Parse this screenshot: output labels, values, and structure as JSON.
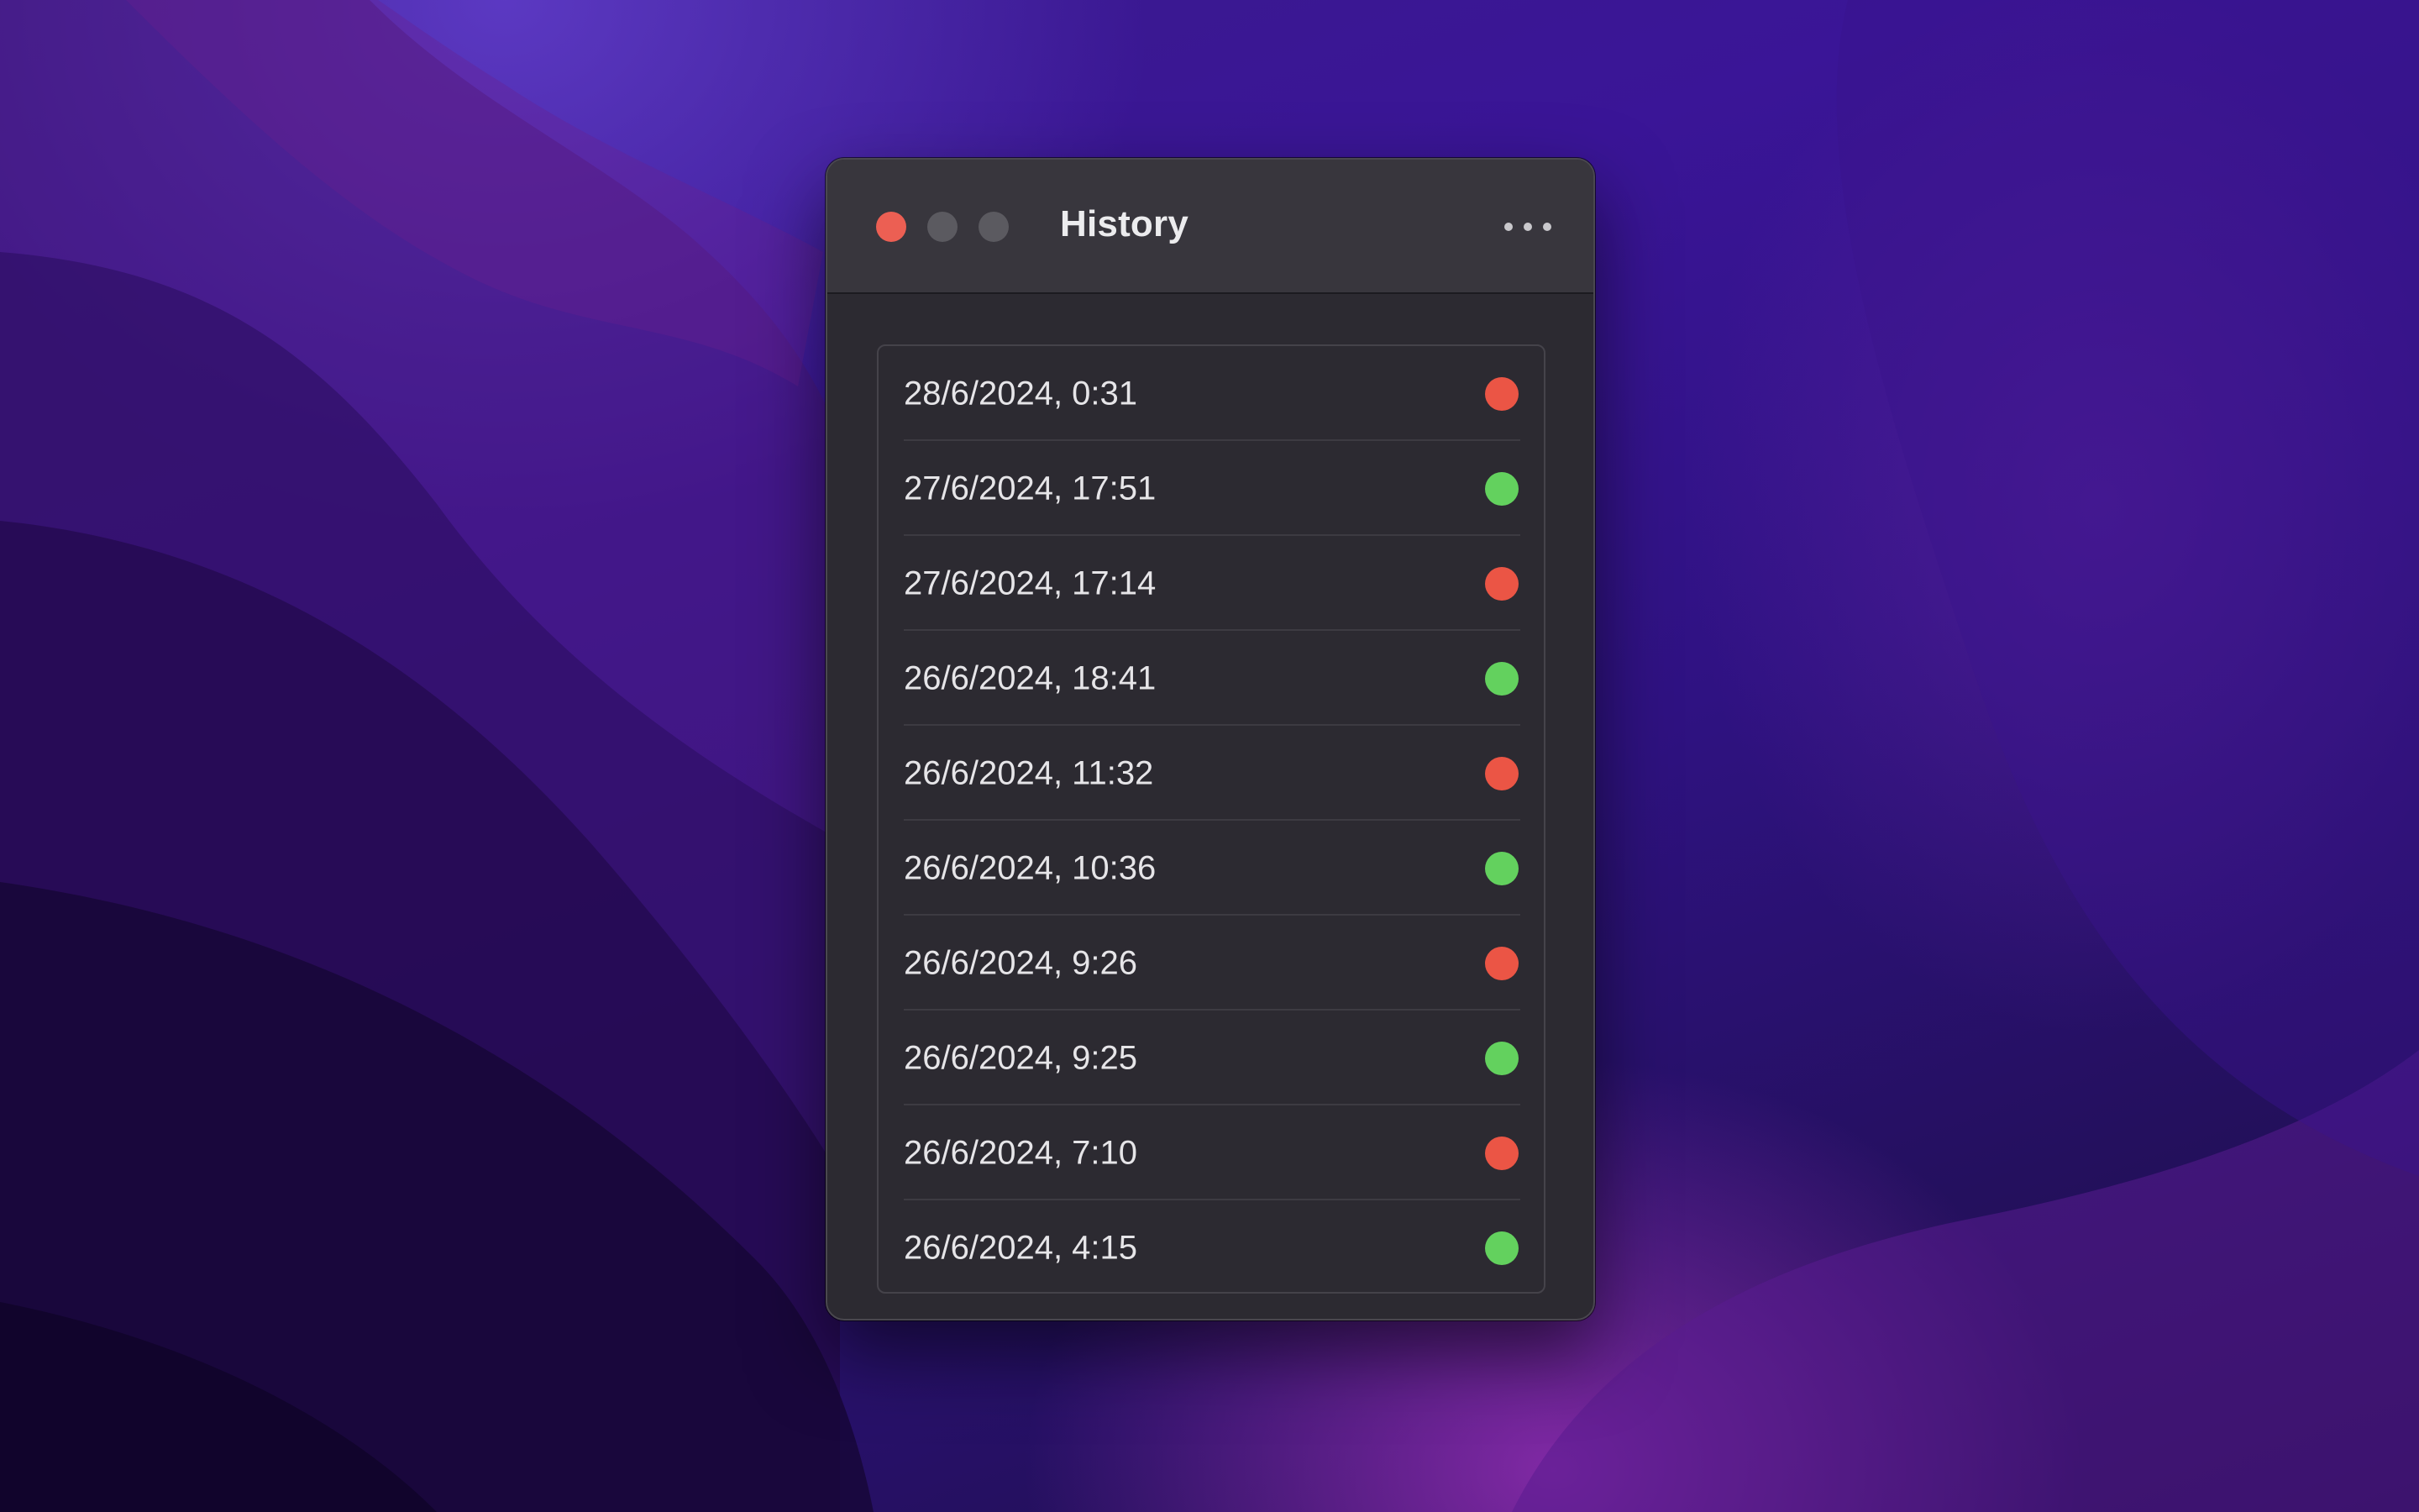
{
  "window": {
    "title": "History",
    "more_icon": "ellipsis-icon"
  },
  "colors": {
    "close": "#ec5f53",
    "inactive": "#5b5a60",
    "status_red": "#eb5545",
    "status_green": "#63d15e"
  },
  "history": {
    "items": [
      {
        "label": "28/6/2024, 0:31",
        "status": "red"
      },
      {
        "label": "27/6/2024, 17:51",
        "status": "green"
      },
      {
        "label": "27/6/2024, 17:14",
        "status": "red"
      },
      {
        "label": "26/6/2024, 18:41",
        "status": "green"
      },
      {
        "label": "26/6/2024, 11:32",
        "status": "red"
      },
      {
        "label": "26/6/2024, 10:36",
        "status": "green"
      },
      {
        "label": "26/6/2024, 9:26",
        "status": "red"
      },
      {
        "label": "26/6/2024, 9:25",
        "status": "green"
      },
      {
        "label": "26/6/2024, 7:10",
        "status": "red"
      },
      {
        "label": "26/6/2024, 4:15",
        "status": "green"
      }
    ]
  }
}
